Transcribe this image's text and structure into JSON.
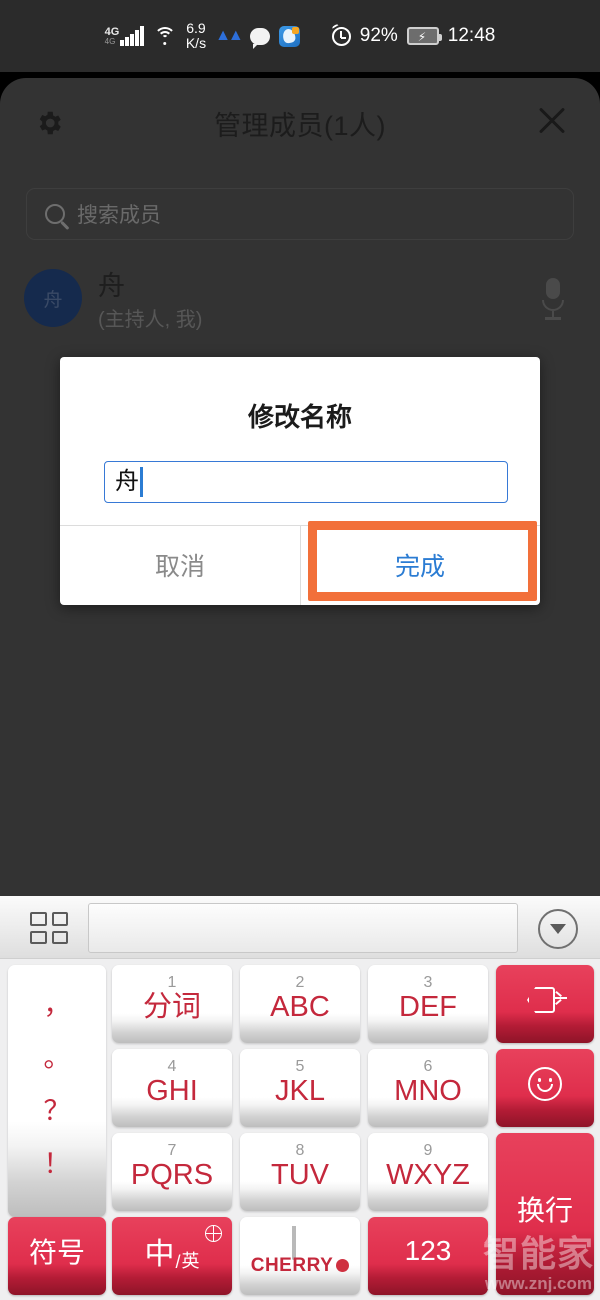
{
  "status_bar": {
    "network_type": "4G",
    "network_sub": "4G",
    "speed_value": "6.9",
    "speed_unit": "K/s",
    "battery_percent": "92%",
    "time": "12:48",
    "icons": [
      "signal-icon",
      "wifi-icon",
      "messenger-icon",
      "chat-bubble-icon",
      "app-icon",
      "alarm-icon",
      "battery-charging-icon"
    ]
  },
  "app": {
    "title": "管理成员(1人)",
    "gear_icon": "gear-icon",
    "close_icon": "close-icon",
    "search": {
      "placeholder": "搜索成员",
      "icon": "search-icon"
    },
    "members": [
      {
        "avatar_text": "舟",
        "name": "舟",
        "role": "(主持人, 我)",
        "mic_icon": "microphone-icon"
      }
    ]
  },
  "dialog": {
    "title": "修改名称",
    "input_value": "舟",
    "cancel_label": "取消",
    "confirm_label": "完成",
    "highlight_color": "#f2703a",
    "accent_color": "#2b7cd3"
  },
  "keyboard": {
    "toolbar": {
      "grid_icon": "grid-menu-icon",
      "candidate_text": "",
      "hide_icon": "chevron-down-icon"
    },
    "punctuation_key": {
      "name": "punctuation-key",
      "marks": [
        "，",
        "。",
        "？",
        "！"
      ]
    },
    "keys": [
      {
        "num": "1",
        "label": "分词",
        "style": "white",
        "name": "key-1-fenci"
      },
      {
        "num": "2",
        "label": "ABC",
        "style": "white",
        "name": "key-2-abc"
      },
      {
        "num": "3",
        "label": "DEF",
        "style": "white",
        "name": "key-3-def"
      },
      {
        "num": "4",
        "label": "GHI",
        "style": "white",
        "name": "key-4-ghi"
      },
      {
        "num": "5",
        "label": "JKL",
        "style": "white",
        "name": "key-5-jkl"
      },
      {
        "num": "6",
        "label": "MNO",
        "style": "white",
        "name": "key-6-mno"
      },
      {
        "num": "7",
        "label": "PQRS",
        "style": "white",
        "name": "key-7-pqrs"
      },
      {
        "num": "8",
        "label": "TUV",
        "style": "white",
        "name": "key-8-tuv"
      },
      {
        "num": "9",
        "label": "WXYZ",
        "style": "white",
        "name": "key-9-wxyz"
      }
    ],
    "backspace": {
      "icon": "backspace-icon"
    },
    "emoji": {
      "icon": "smiley-icon"
    },
    "enter": {
      "label": "换行"
    },
    "symbol": {
      "label": "符号"
    },
    "lang": {
      "primary": "中",
      "slash": "/",
      "secondary": "英",
      "globe_icon": "globe-icon"
    },
    "voice": {
      "brand": "CHERRY",
      "mic_icon": "microphone-icon",
      "logo_icon": "cherry-logo-icon"
    },
    "numeric": {
      "label": "123"
    }
  },
  "watermark": {
    "line1": "智能家",
    "line2": "www.znj.com"
  }
}
